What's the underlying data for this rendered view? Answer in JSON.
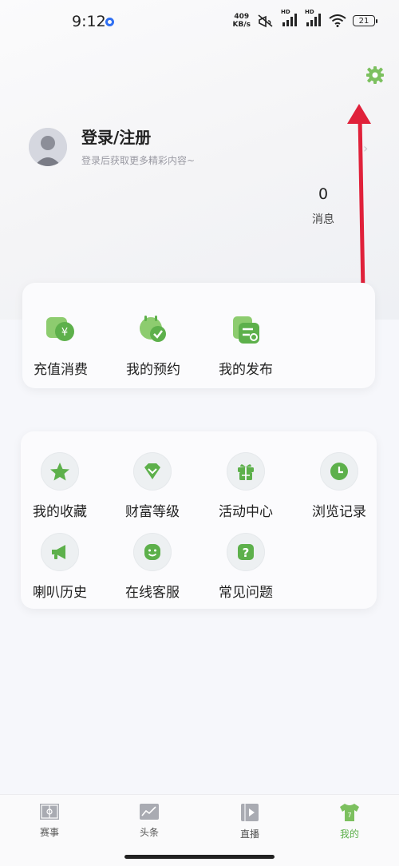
{
  "status_bar": {
    "time": "9:12",
    "net_speed_value": "409",
    "net_speed_unit": "KB/s",
    "hd1": "HD",
    "hd2": "HD",
    "battery": "21"
  },
  "profile": {
    "login_title": "登录/注册",
    "login_subtitle": "登录后获取更多精彩内容~",
    "message_count": "0",
    "message_label": "消息"
  },
  "quick_actions": [
    {
      "label": "充值消费",
      "icon": "recharge-icon"
    },
    {
      "label": "我的预约",
      "icon": "reservation-icon"
    },
    {
      "label": "我的发布",
      "icon": "publish-icon"
    }
  ],
  "services": [
    {
      "label": "我的收藏",
      "icon": "star-icon"
    },
    {
      "label": "财富等级",
      "icon": "gem-icon"
    },
    {
      "label": "活动中心",
      "icon": "gift-icon"
    },
    {
      "label": "浏览记录",
      "icon": "clock-icon"
    },
    {
      "label": "喇叭历史",
      "icon": "megaphone-icon"
    },
    {
      "label": "在线客服",
      "icon": "smile-icon"
    },
    {
      "label": "常见问题",
      "icon": "question-icon"
    }
  ],
  "tabs": [
    {
      "label": "赛事",
      "icon": "field-icon"
    },
    {
      "label": "头条",
      "icon": "chart-board-icon"
    },
    {
      "label": "直播",
      "icon": "play-icon"
    },
    {
      "label": "我的",
      "icon": "jersey-icon",
      "active": true
    }
  ],
  "colors": {
    "accent": "#5db04b",
    "arrow": "#e0213a"
  }
}
